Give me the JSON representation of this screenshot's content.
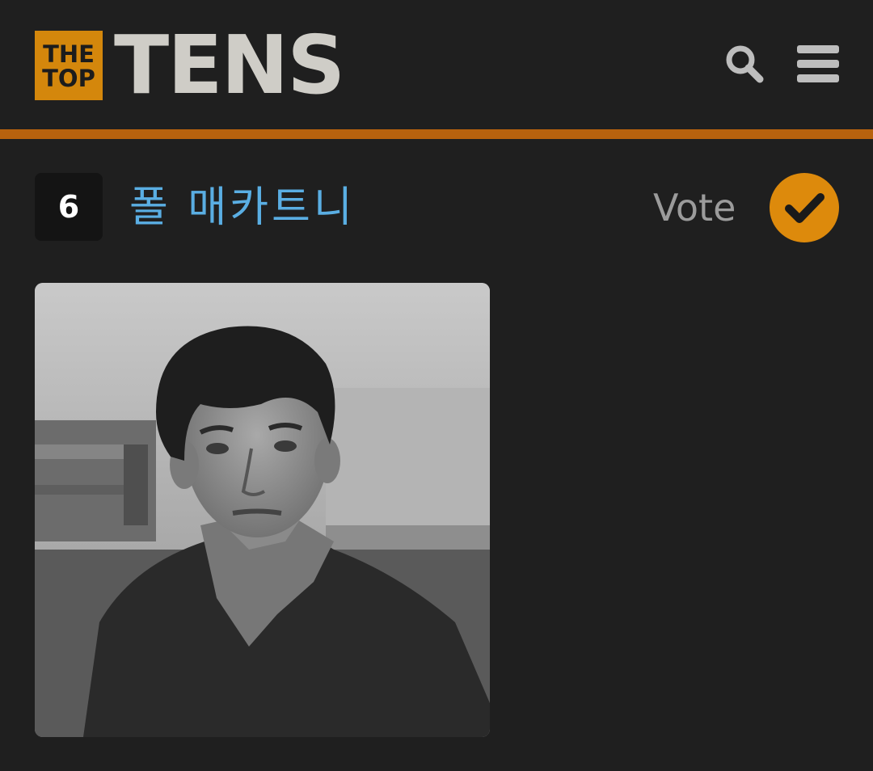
{
  "header": {
    "logo": {
      "badge_line1": "THE",
      "badge_line2": "TOP",
      "wordmark": "TENS"
    },
    "icons": {
      "search": "search-icon",
      "menu": "hamburger-menu-icon"
    },
    "colors": {
      "background": "#1f1f1f",
      "accent_rule": "#b8620e",
      "logo_badge": "#d4870c",
      "wordmark": "#cfcdc7"
    }
  },
  "item": {
    "rank": "6",
    "title": "폴 매카트니",
    "vote_label": "Vote",
    "vote_icon": "checkmark-icon",
    "colors": {
      "title": "#5aaee3",
      "vote_button": "#dd8a0c",
      "rank_box": "#141414"
    },
    "image": {
      "kind": "black-and-white portrait photograph"
    }
  }
}
